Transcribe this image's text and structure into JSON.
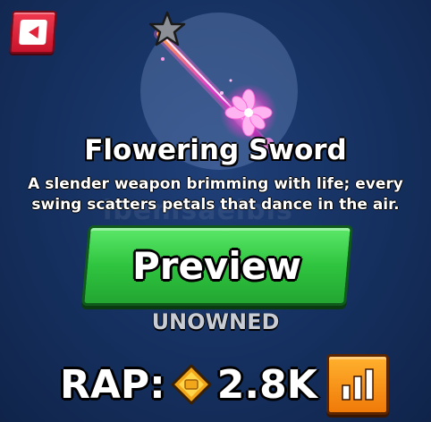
{
  "item": {
    "name": "Flowering Sword",
    "description": "A slender weapon brimming with life; every swing scatters petals that dance in the air."
  },
  "watermark": "ibemsaelbis",
  "preview_button": {
    "label": "Preview"
  },
  "ownership_status": "UNOWNED",
  "rap": {
    "label": "RAP:",
    "value": "2.8K"
  },
  "icons": {
    "back": "back-arrow-icon",
    "star": "star-icon",
    "currency": "diamond-coin-icon",
    "chart": "bar-chart-icon"
  },
  "colors": {
    "background": "#15305f",
    "back_button": "#e0243c",
    "preview_button": "#2fc43f",
    "chart_button": "#f7931a",
    "sword_glow": "#e040c8"
  }
}
